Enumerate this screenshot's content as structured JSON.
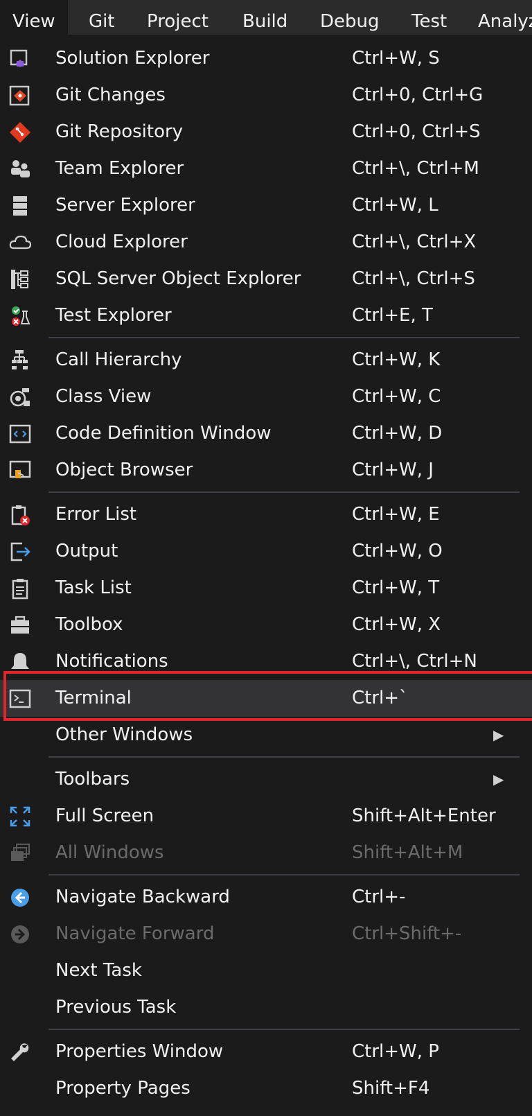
{
  "menubar": {
    "items": [
      {
        "label": "View"
      },
      {
        "label": "Git"
      },
      {
        "label": "Project"
      },
      {
        "label": "Build"
      },
      {
        "label": "Debug"
      },
      {
        "label": "Test"
      },
      {
        "label": "Analyz"
      }
    ]
  },
  "menu": {
    "items": [
      {
        "label": "Solution Explorer",
        "shortcut": "Ctrl+W, S",
        "icon": "solution-explorer-icon"
      },
      {
        "label": "Git Changes",
        "shortcut": "Ctrl+0, Ctrl+G",
        "icon": "git-changes-icon"
      },
      {
        "label": "Git Repository",
        "shortcut": "Ctrl+0, Ctrl+S",
        "icon": "git-repository-icon"
      },
      {
        "label": "Team Explorer",
        "shortcut": "Ctrl+\\, Ctrl+M",
        "icon": "team-explorer-icon"
      },
      {
        "label": "Server Explorer",
        "shortcut": "Ctrl+W, L",
        "icon": "server-explorer-icon"
      },
      {
        "label": "Cloud Explorer",
        "shortcut": "Ctrl+\\, Ctrl+X",
        "icon": "cloud-icon"
      },
      {
        "label": "SQL Server Object Explorer",
        "shortcut": "Ctrl+\\, Ctrl+S",
        "icon": "sql-server-icon"
      },
      {
        "label": "Test Explorer",
        "shortcut": "Ctrl+E, T",
        "icon": "test-explorer-icon"
      },
      {
        "label": "Call Hierarchy",
        "shortcut": "Ctrl+W, K",
        "icon": "call-hierarchy-icon"
      },
      {
        "label": "Class View",
        "shortcut": "Ctrl+W, C",
        "icon": "class-view-icon"
      },
      {
        "label": "Code Definition Window",
        "shortcut": "Ctrl+W, D",
        "icon": "code-definition-icon"
      },
      {
        "label": "Object Browser",
        "shortcut": "Ctrl+W, J",
        "icon": "object-browser-icon"
      },
      {
        "label": "Error List",
        "shortcut": "Ctrl+W, E",
        "icon": "error-list-icon"
      },
      {
        "label": "Output",
        "shortcut": "Ctrl+W, O",
        "icon": "output-icon"
      },
      {
        "label": "Task List",
        "shortcut": "Ctrl+W, T",
        "icon": "task-list-icon"
      },
      {
        "label": "Toolbox",
        "shortcut": "Ctrl+W, X",
        "icon": "toolbox-icon"
      },
      {
        "label": "Notifications",
        "shortcut": "Ctrl+\\, Ctrl+N",
        "icon": "bell-icon"
      },
      {
        "label": "Terminal",
        "shortcut": "Ctrl+`",
        "icon": "terminal-icon"
      },
      {
        "label": "Other Windows",
        "shortcut": "",
        "icon": ""
      },
      {
        "label": "Toolbars",
        "shortcut": "",
        "icon": ""
      },
      {
        "label": "Full Screen",
        "shortcut": "Shift+Alt+Enter",
        "icon": "full-screen-icon"
      },
      {
        "label": "All Windows",
        "shortcut": "Shift+Alt+M",
        "icon": "all-windows-icon"
      },
      {
        "label": "Navigate Backward",
        "shortcut": "Ctrl+-",
        "icon": "navigate-backward-icon"
      },
      {
        "label": "Navigate Forward",
        "shortcut": "Ctrl+Shift+-",
        "icon": "navigate-forward-icon"
      },
      {
        "label": "Next Task",
        "shortcut": "",
        "icon": ""
      },
      {
        "label": "Previous Task",
        "shortcut": "",
        "icon": ""
      },
      {
        "label": "Properties Window",
        "shortcut": "Ctrl+W, P",
        "icon": "wrench-icon"
      },
      {
        "label": "Property Pages",
        "shortcut": "Shift+F4",
        "icon": ""
      }
    ],
    "submenu_chevron": "▶"
  },
  "colors": {
    "background": "#1b1b1c",
    "highlight": "#333335",
    "annotation_box": "#e0262a",
    "disabled_text": "#6b6b6b"
  }
}
